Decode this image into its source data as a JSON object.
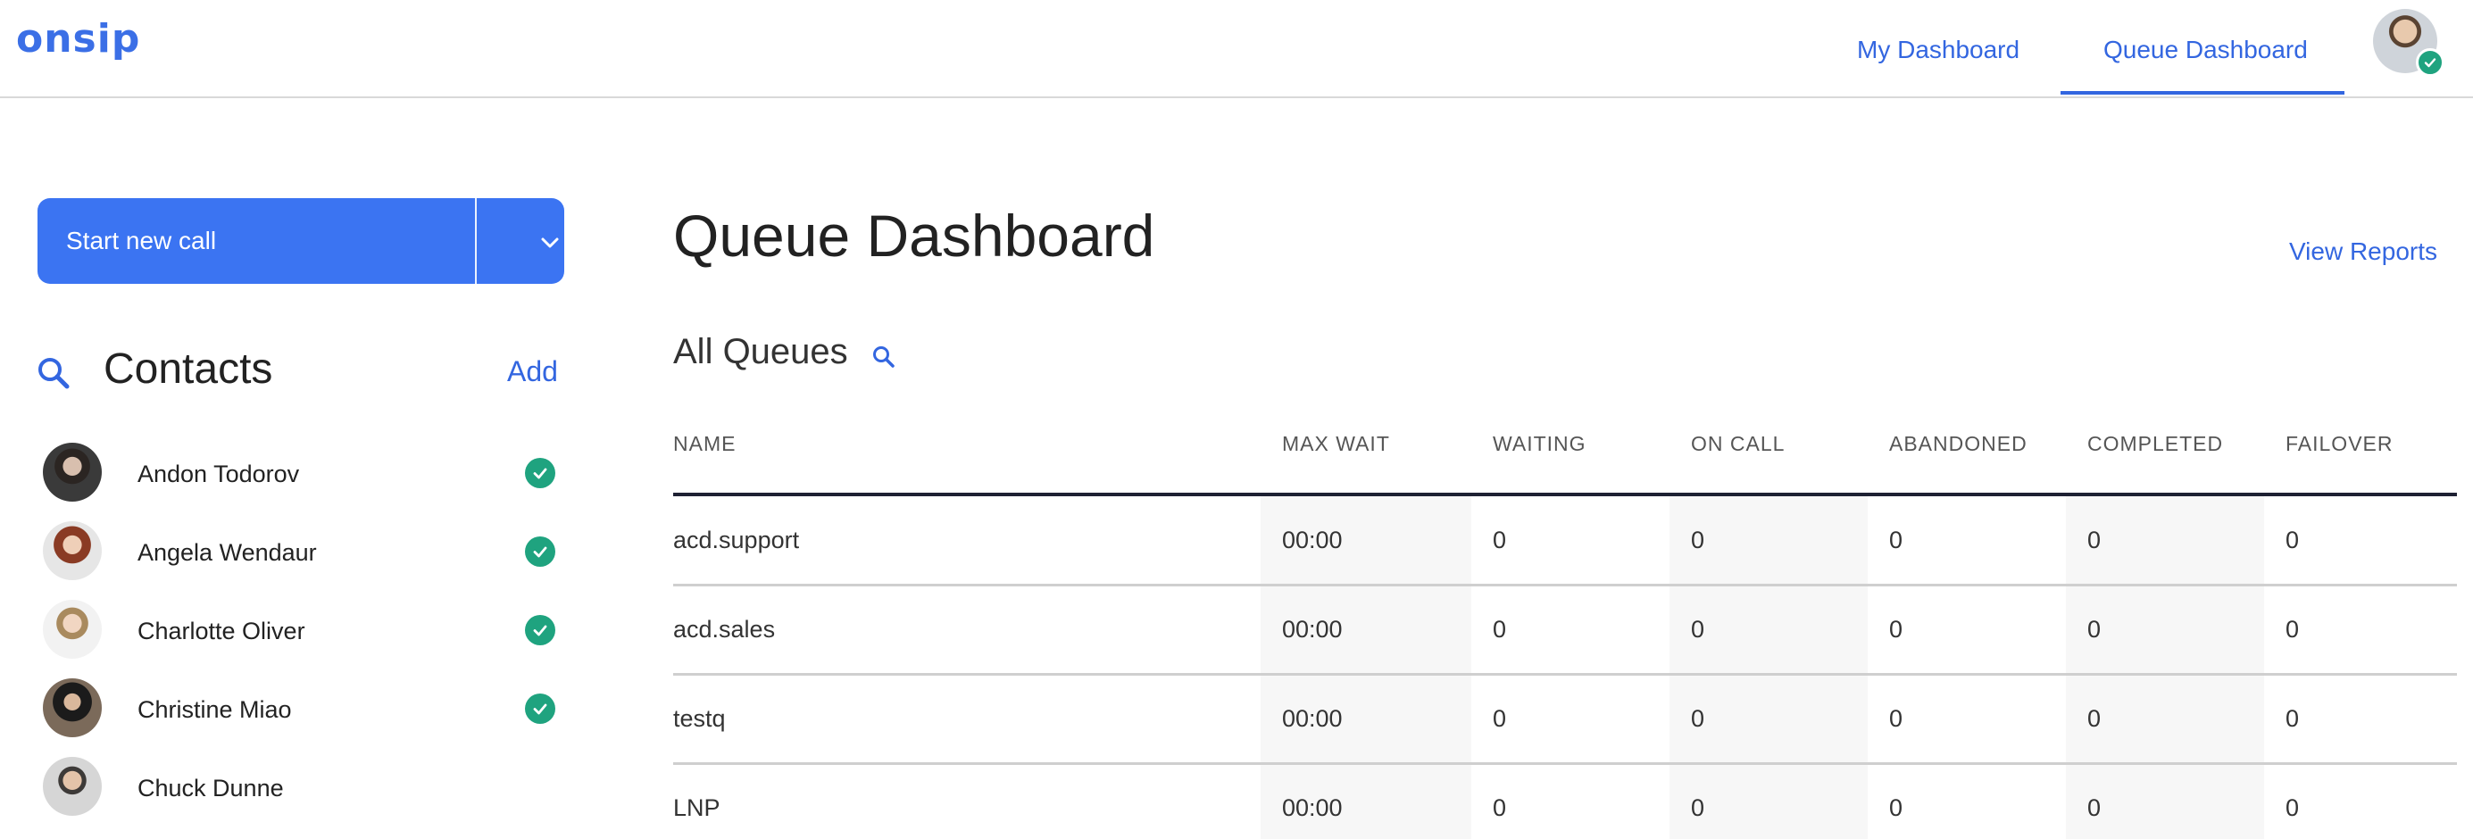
{
  "header": {
    "logo": "onsip",
    "nav": [
      {
        "label": "My Dashboard"
      },
      {
        "label": "Queue Dashboard",
        "active": true
      }
    ],
    "accent_color": "#3366e0",
    "status_color": "#1fa37f"
  },
  "sidebar": {
    "start_call_label": "Start new call",
    "contacts_title": "Contacts",
    "add_label": "Add",
    "contacts": [
      {
        "name": "Andon Todorov",
        "online": true
      },
      {
        "name": "Angela Wendaur",
        "online": true
      },
      {
        "name": "Charlotte Oliver",
        "online": true
      },
      {
        "name": "Christine Miao",
        "online": true
      },
      {
        "name": "Chuck Dunne",
        "online": false
      }
    ]
  },
  "main": {
    "title": "Queue Dashboard",
    "view_reports": "View Reports",
    "queues_title": "All Queues",
    "columns": [
      "NAME",
      "MAX WAIT",
      "WAITING",
      "ON CALL",
      "ABANDONED",
      "COMPLETED",
      "FAILOVER"
    ],
    "rows": [
      [
        "acd.support",
        "00:00",
        "0",
        "0",
        "0",
        "0",
        "0"
      ],
      [
        "acd.sales",
        "00:00",
        "0",
        "0",
        "0",
        "0",
        "0"
      ],
      [
        "testq",
        "00:00",
        "0",
        "0",
        "0",
        "0",
        "0"
      ],
      [
        "LNP",
        "00:00",
        "0",
        "0",
        "0",
        "0",
        "0"
      ]
    ]
  }
}
